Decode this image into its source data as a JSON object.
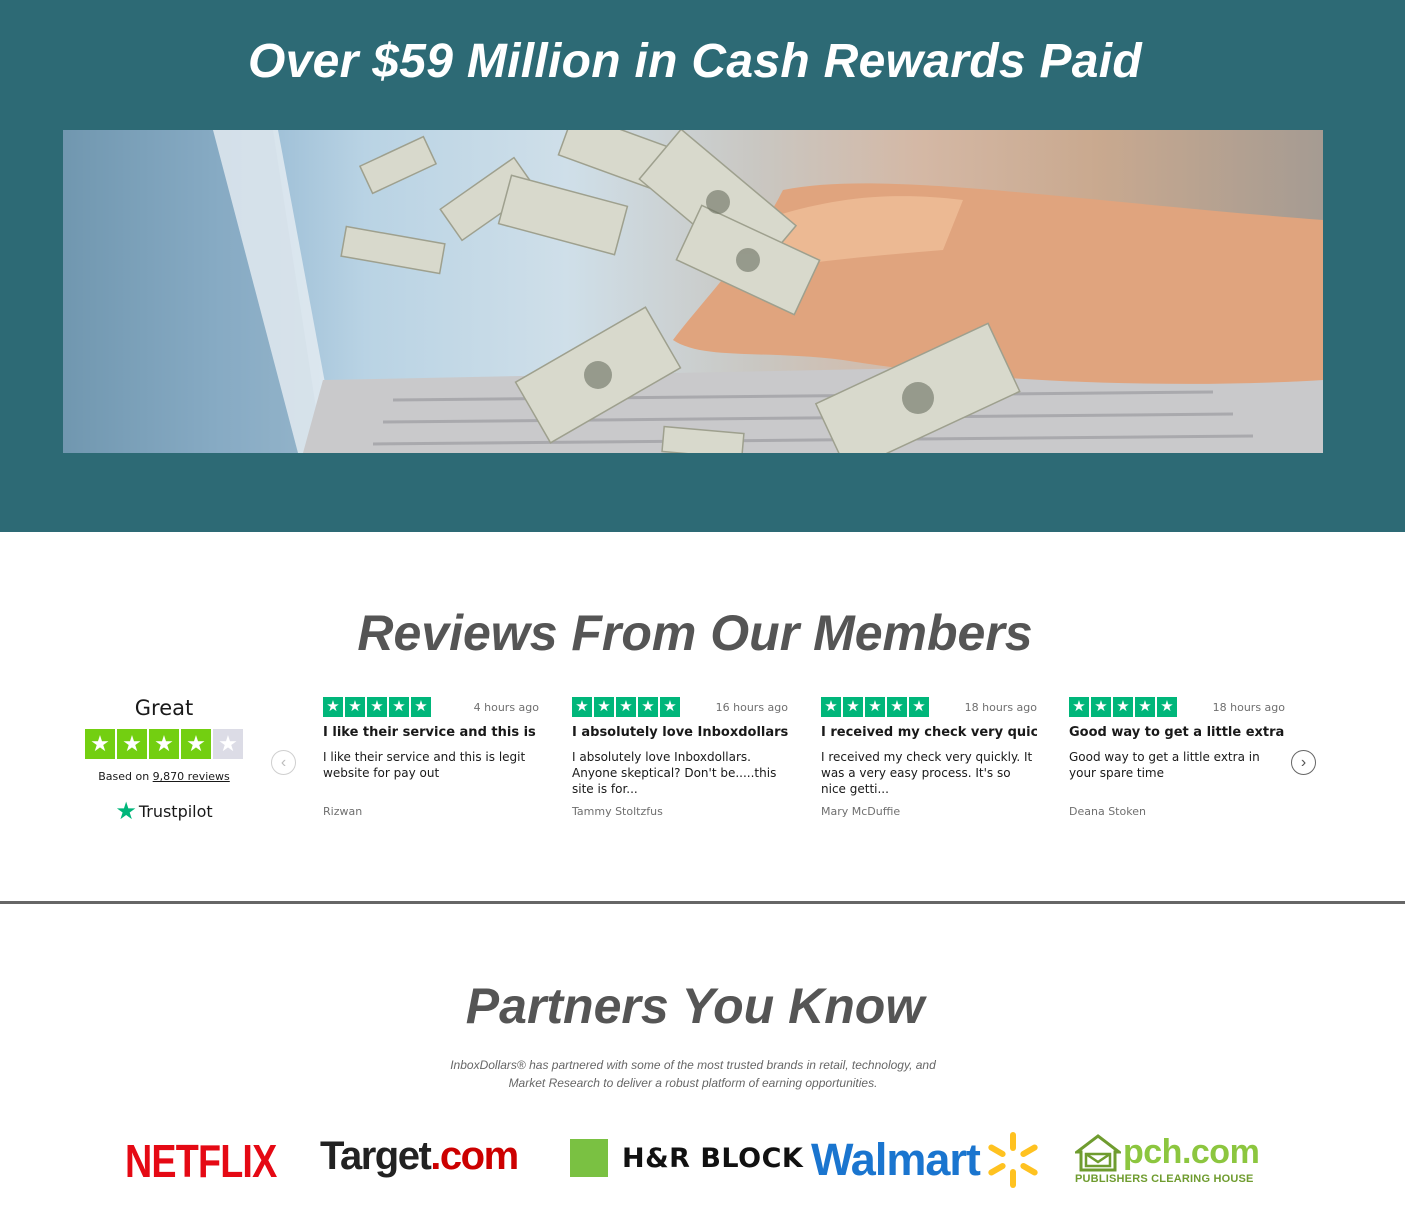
{
  "hero": {
    "title": "Over $59 Million in Cash Rewards Paid",
    "image": "hand-typing-laptop-money-flying"
  },
  "reviews": {
    "title": "Reviews From Our Members",
    "summary": {
      "rating_word": "Great",
      "rating_stars": 4,
      "based_on_prefix": "Based on",
      "review_count_link": "9,870 reviews",
      "brand": "Trustpilot"
    },
    "items": [
      {
        "stars": 5,
        "time": "4 hours ago",
        "title": "I like their service and this is l...",
        "text": "I like their service and this is legit website for pay out",
        "author": "Rizwan"
      },
      {
        "stars": 5,
        "time": "16 hours ago",
        "title": "I absolutely love Inboxdollars",
        "text": "I absolutely love Inboxdollars. Anyone skeptical? Don't be.....this site is for...",
        "author": "Tammy Stoltzfus"
      },
      {
        "stars": 5,
        "time": "18 hours ago",
        "title": "I received my check very quickly",
        "text": "I received my check very quickly. It was a very easy process. It's so nice getti...",
        "author": "Mary McDuffie"
      },
      {
        "stars": 5,
        "time": "18 hours ago",
        "title": "Good way to get a little extra i...",
        "text": "Good way to get a little extra in your spare time",
        "author": "Deana Stoken"
      }
    ],
    "prev_icon": "chevron-left-icon",
    "next_icon": "chevron-right-icon"
  },
  "partners": {
    "title": "Partners You Know",
    "description": "InboxDollars® has partnered with some of the most trusted brands in retail, technology, and Market Research to deliver a robust platform of earning opportunities.",
    "logos": {
      "netflix": "NETFLIX",
      "target_main": "Target",
      "target_dotcom": ".com",
      "hrblock": "H&R BLOCK",
      "walmart": "Walmart",
      "pch_main": "pch.com",
      "pch_sub": "PUBLISHERS CLEARING HOUSE"
    }
  },
  "colors": {
    "hero_bg": "#2d6a75",
    "trustpilot_green": "#00b67a",
    "summary_star_green": "#73cf11",
    "heading_gray": "#555555"
  }
}
